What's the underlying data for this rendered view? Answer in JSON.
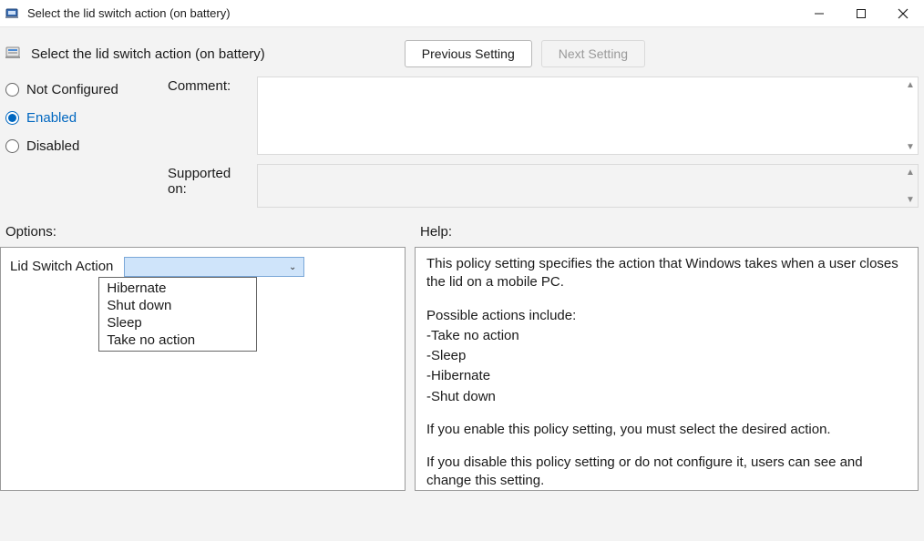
{
  "window": {
    "title": "Select the lid switch action (on battery)"
  },
  "header": {
    "title": "Select the lid switch action (on battery)",
    "previous_setting": "Previous Setting",
    "next_setting": "Next Setting"
  },
  "state": {
    "not_configured": "Not Configured",
    "enabled": "Enabled",
    "disabled": "Disabled",
    "selected": "enabled"
  },
  "fields": {
    "comment_label": "Comment:",
    "comment_value": "",
    "supported_label": "Supported on:",
    "supported_value": ""
  },
  "sections": {
    "options": "Options:",
    "help": "Help:"
  },
  "options": {
    "lid_switch_label": "Lid Switch Action",
    "selected_value": "",
    "dropdown_items": [
      "Hibernate",
      "Shut down",
      "Sleep",
      "Take no action"
    ]
  },
  "help": {
    "l1": "This policy setting specifies the action that Windows takes when a user closes the lid on a mobile PC.",
    "l2": "Possible actions include:",
    "l3": "-Take no action",
    "l4": "-Sleep",
    "l5": "-Hibernate",
    "l6": "-Shut down",
    "l7": "If you enable this policy setting, you must select the desired action.",
    "l8": "If you disable this policy setting or do not configure it, users can see and change this setting."
  }
}
